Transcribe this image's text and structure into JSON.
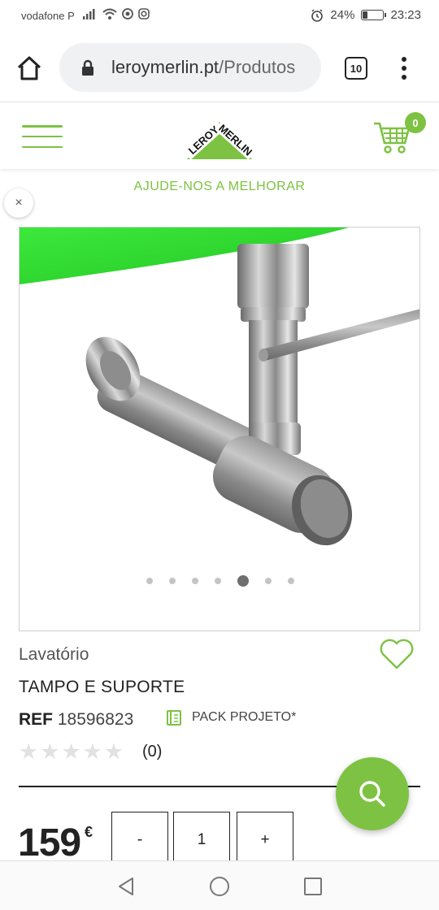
{
  "status_bar": {
    "carrier": "vodafone P",
    "battery_text": "24%",
    "battery_level": 0.24,
    "time": "23:23"
  },
  "browser": {
    "url_domain": "leroymerlin.pt",
    "url_path": "/Produtos",
    "tab_count": "10"
  },
  "header": {
    "logo_text_left": "LEROY",
    "logo_text_right": "MERLIN",
    "cart_count": "0",
    "accent_color": "#7dc242"
  },
  "banner": {
    "help_text": "AJUDE-NOS A MELHORAR",
    "close_label": "×"
  },
  "carousel": {
    "dot_count": 7,
    "active_index": 4
  },
  "product": {
    "category": "Lavatório",
    "title": "TAMPO E SUPORTE",
    "ref_label": "REF",
    "ref_number": "18596823",
    "pack_label": "PACK PROJETO*",
    "rating": 0,
    "max_rating": 5,
    "review_count": "(0)",
    "price": "159",
    "currency": "€"
  },
  "quantity": {
    "minus_label": "-",
    "value": "1",
    "plus_label": "+"
  }
}
